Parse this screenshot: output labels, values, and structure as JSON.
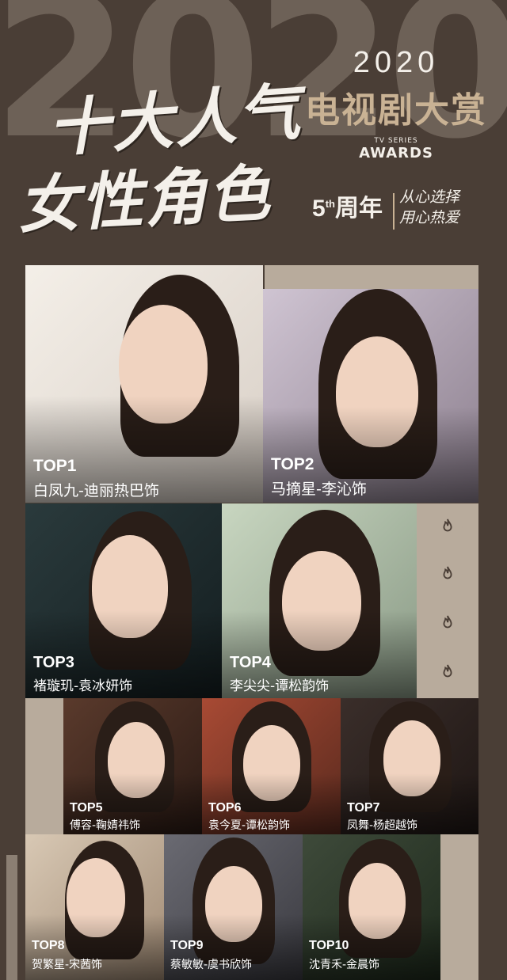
{
  "header": {
    "title_line1": "十大人气",
    "title_line2": "女性角色",
    "bg_year": "2020",
    "brand_year": "2020",
    "brand_name": "电视剧大赏",
    "brand_tv": "TV SERIES",
    "brand_awards": "AWARDS",
    "anniv_num": "5",
    "anniv_sup": "th",
    "anniv_cn": "周年",
    "slogan_line1": "从心选择",
    "slogan_line2": "用心热爱"
  },
  "colors": {
    "background": "#4a3e36",
    "accent": "#c9b294",
    "band": "#b8ab9c"
  },
  "rankings": [
    {
      "rank": "TOP1",
      "role": "白凤九-迪丽热巴饰"
    },
    {
      "rank": "TOP2",
      "role": "马摘星-李沁饰"
    },
    {
      "rank": "TOP3",
      "role": "褚璇玑-袁冰妍饰"
    },
    {
      "rank": "TOP4",
      "role": "李尖尖-谭松韵饰"
    },
    {
      "rank": "TOP5",
      "role": "傅容-鞠婧祎饰"
    },
    {
      "rank": "TOP6",
      "role": "袁今夏-谭松韵饰"
    },
    {
      "rank": "TOP7",
      "role": "凤舞-杨超越饰"
    },
    {
      "rank": "TOP8",
      "role": "贺繁星-宋茜饰"
    },
    {
      "rank": "TOP9",
      "role": "蔡敏敏-虞书欣饰"
    },
    {
      "rank": "TOP10",
      "role": "沈青禾-金晨饰"
    }
  ],
  "icons": [
    "fire-icon",
    "fire-icon",
    "fire-icon",
    "fire-icon"
  ]
}
